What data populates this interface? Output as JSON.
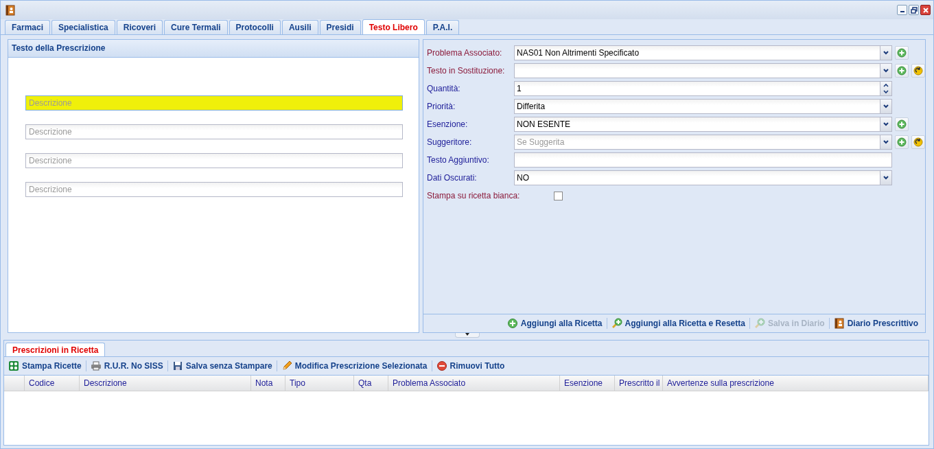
{
  "tabs": [
    {
      "label": "Farmaci",
      "selected": false
    },
    {
      "label": "Specialistica",
      "selected": false
    },
    {
      "label": "Ricoveri",
      "selected": false
    },
    {
      "label": "Cure Termali",
      "selected": false
    },
    {
      "label": "Protocolli",
      "selected": false
    },
    {
      "label": "Ausili",
      "selected": false
    },
    {
      "label": "Presidi",
      "selected": false
    },
    {
      "label": "Testo Libero",
      "selected": true
    },
    {
      "label": "P.A.I.",
      "selected": false
    }
  ],
  "prescription_panel": {
    "title": "Testo della Prescrizione",
    "fields": [
      {
        "placeholder": "Descrizione",
        "highlighted": true
      },
      {
        "placeholder": "Descrizione",
        "highlighted": false
      },
      {
        "placeholder": "Descrizione",
        "highlighted": false
      },
      {
        "placeholder": "Descrizione",
        "highlighted": false
      }
    ]
  },
  "form": {
    "fields": [
      {
        "kind": "combo",
        "label": "Problema Associato:",
        "required": true,
        "value": "NAS01 Non Altrimenti Specificato",
        "add_button": true
      },
      {
        "kind": "combo",
        "label": "Testo in Sostituzione:",
        "required": true,
        "add_button": true,
        "reset_button": true
      },
      {
        "kind": "spinner",
        "label": "Quantità:",
        "required": false,
        "value": "1"
      },
      {
        "kind": "combo",
        "label": "Priorità:",
        "required": false,
        "value": "Differita"
      },
      {
        "kind": "combo",
        "label": "Esenzione:",
        "required": false,
        "value": "NON ESENTE",
        "add_button": true
      },
      {
        "kind": "combo",
        "label": "Suggeritore:",
        "required": false,
        "placeholder": "Se Suggerita",
        "add_button": true,
        "reset_button": true
      },
      {
        "kind": "text",
        "label": "Testo Aggiuntivo:",
        "required": false
      },
      {
        "kind": "combo",
        "label": "Dati Oscurati:",
        "required": false,
        "value": "NO"
      },
      {
        "kind": "checkbox",
        "label": "Stampa su ricetta bianca:",
        "required": true,
        "checked": false
      }
    ],
    "actions": [
      {
        "kind": "add",
        "label": "Aggiungi alla Ricetta",
        "disabled": false
      },
      {
        "kind": "add-reset",
        "label": "Aggiungi alla Ricetta e Resetta",
        "disabled": false
      },
      {
        "kind": "add-reset",
        "label": "Salva in Diario",
        "disabled": true
      },
      {
        "kind": "book",
        "label": "Diario Prescrittivo",
        "disabled": false
      }
    ]
  },
  "bottom_panel": {
    "tabs": [
      {
        "label": "Prescrizioni in Ricetta",
        "selected": true
      }
    ],
    "toolbar": [
      {
        "kind": "print",
        "label": "Stampa Ricette"
      },
      {
        "kind": "printer",
        "label": "R.U.R. No SISS"
      },
      {
        "kind": "disk",
        "label": "Salva senza Stampare"
      },
      {
        "kind": "pencil",
        "label": "Modifica Prescrizione Selezionata"
      },
      {
        "kind": "remove",
        "label": "Rimuovi Tutto"
      }
    ],
    "table": {
      "columns": [
        {
          "label": "Codice"
        },
        {
          "label": "Descrizione"
        },
        {
          "label": "Nota"
        },
        {
          "label": "Tipo"
        },
        {
          "label": "Qta"
        },
        {
          "label": "Problema Associato"
        },
        {
          "label": "Esenzione"
        },
        {
          "label": "Prescritto il"
        },
        {
          "label": "Avvertenze sulla prescrizione"
        }
      ]
    }
  }
}
